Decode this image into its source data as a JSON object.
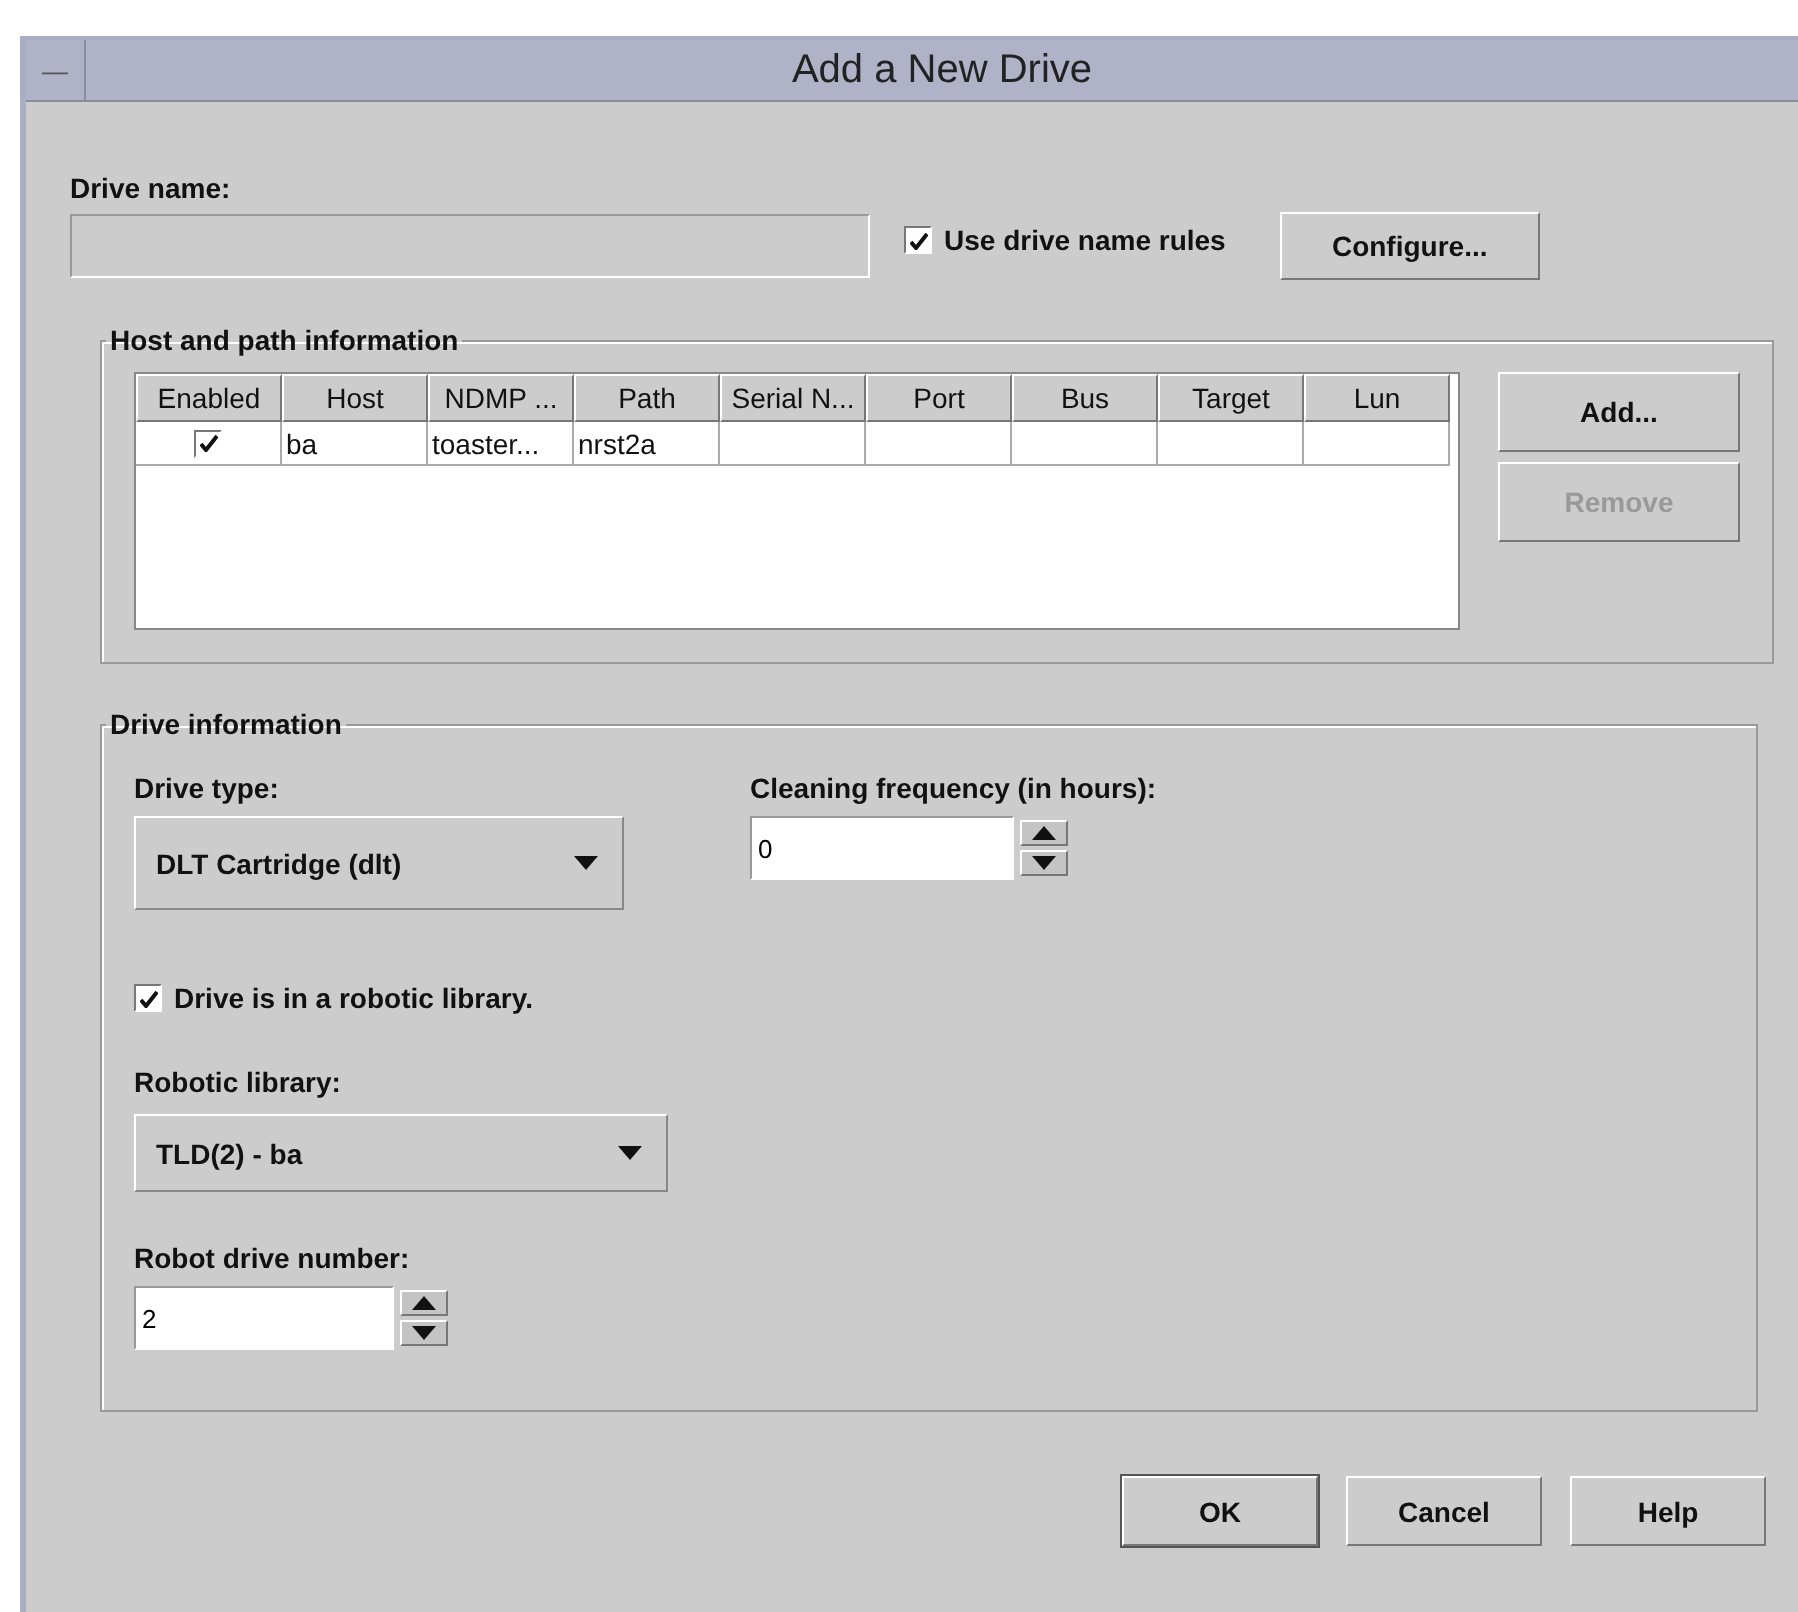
{
  "window": {
    "title": "Add a New Drive",
    "menu_button": "—"
  },
  "drive_name": {
    "label": "Drive name:",
    "disabled": true,
    "use_rules": {
      "label": "Use drive name rules",
      "checked": true
    },
    "configure_button": "Configure..."
  },
  "host_path": {
    "title": "Host and path information",
    "table": {
      "columns": [
        "Enabled",
        "Host",
        "NDMP ...",
        "Path",
        "Serial N...",
        "Port",
        "Bus",
        "Target",
        "Lun"
      ],
      "rows": [
        {
          "cells": [
            {
              "kind": "checkbox",
              "checked": true
            },
            {
              "kind": "text",
              "text": "ba"
            },
            {
              "kind": "text",
              "text": "toaster..."
            },
            {
              "kind": "text",
              "text": "nrst2a"
            },
            {
              "kind": "empty"
            },
            {
              "kind": "empty"
            },
            {
              "kind": "empty"
            },
            {
              "kind": "empty"
            },
            {
              "kind": "empty"
            }
          ]
        }
      ]
    },
    "buttons": [
      {
        "label": "Add...",
        "disabled": false
      },
      {
        "label": "Remove",
        "disabled": true
      }
    ]
  },
  "drive_info": {
    "title": "Drive information",
    "drive_type": {
      "label": "Drive type:",
      "value": "DLT Cartridge (dlt)"
    },
    "cleaning": {
      "label": "Cleaning frequency (in hours):",
      "value": "0"
    },
    "robotic": {
      "label": "Drive is in a robotic library.",
      "checked": true
    },
    "robotic_library": {
      "label": "Robotic library:",
      "value": "TLD(2) - ba"
    },
    "robot_drive_number": {
      "label": "Robot drive number:",
      "value": "2"
    }
  },
  "buttons": [
    {
      "label": "OK",
      "default": true
    },
    {
      "label": "Cancel",
      "default": false
    },
    {
      "label": "Help",
      "default": false
    }
  ]
}
